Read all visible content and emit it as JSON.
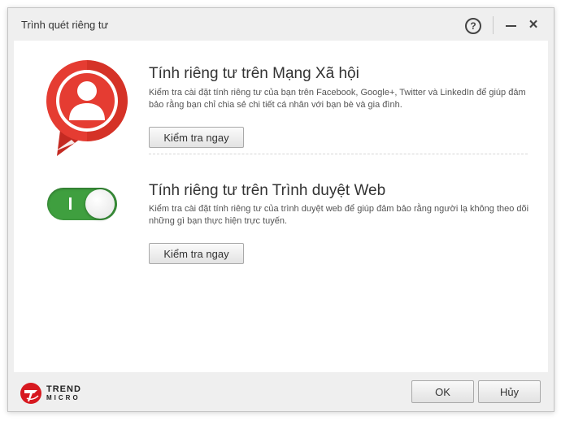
{
  "window": {
    "title": "Trình quét riêng tư",
    "help_glyph": "?"
  },
  "social": {
    "title": "Tính riêng tư trên Mạng Xã hội",
    "description": "Kiểm tra cài đặt tính riêng tư của bạn trên Facebook, Google+, Twitter và LinkedIn để giúp đảm bảo rằng bạn chỉ chia sẻ chi tiết cá nhân với bạn bè và gia đình.",
    "button_label": "Kiểm tra ngay",
    "icon": "user-chat-bubble-icon",
    "icon_color": "#e53c32"
  },
  "browser": {
    "title": "Tính riêng tư trên Trình duyệt Web",
    "description": "Kiểm tra cài đặt tính riêng tư của trình duyệt web để giúp đảm bảo rằng người lạ không theo dõi những gì bạn thực hiện trực tuyến.",
    "button_label": "Kiểm tra ngay",
    "toggle_on": true,
    "toggle_color": "#3f9f3f"
  },
  "footer": {
    "brand_line1": "TREND",
    "brand_line2": "MICRO",
    "ok_label": "OK",
    "cancel_label": "Hủy"
  }
}
